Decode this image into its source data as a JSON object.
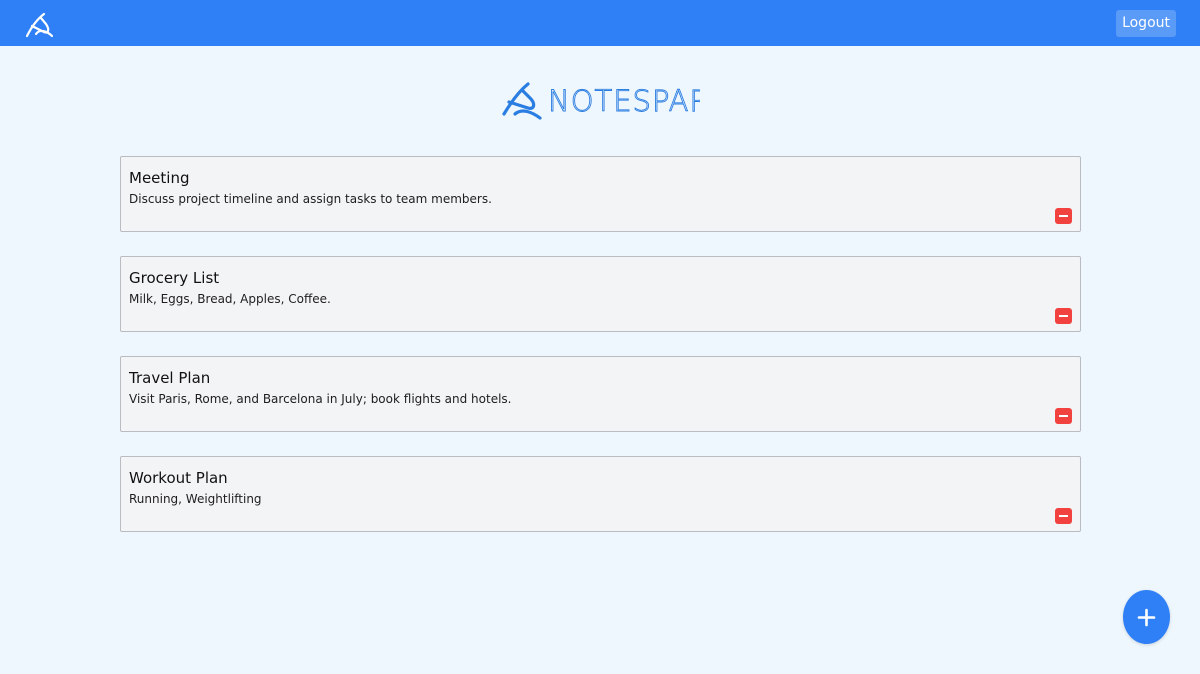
{
  "header": {
    "logo_icon": "notespark-logo-icon",
    "logout_label": "Logout"
  },
  "brand": {
    "name": "NOTESPARK",
    "logo_icon": "notespark-swoosh-icon",
    "color": "#2a7de1"
  },
  "notes": [
    {
      "title": "Meeting",
      "body": "Discuss project timeline and assign tasks to team members.",
      "delete_icon": "minus-icon"
    },
    {
      "title": "Grocery List",
      "body": "Milk, Eggs, Bread, Apples, Coffee.",
      "delete_icon": "minus-icon"
    },
    {
      "title": "Travel Plan",
      "body": "Visit Paris, Rome, and Barcelona in July; book flights and hotels.",
      "delete_icon": "minus-icon"
    },
    {
      "title": "Workout Plan",
      "body": "Running, Weightlifting",
      "delete_icon": "minus-icon"
    }
  ],
  "add_button": {
    "icon": "plus-icon"
  },
  "colors": {
    "primary": "#2f80f6",
    "background": "#eef6fe",
    "card_background": "#f3f4f6",
    "danger": "#f2423f"
  }
}
